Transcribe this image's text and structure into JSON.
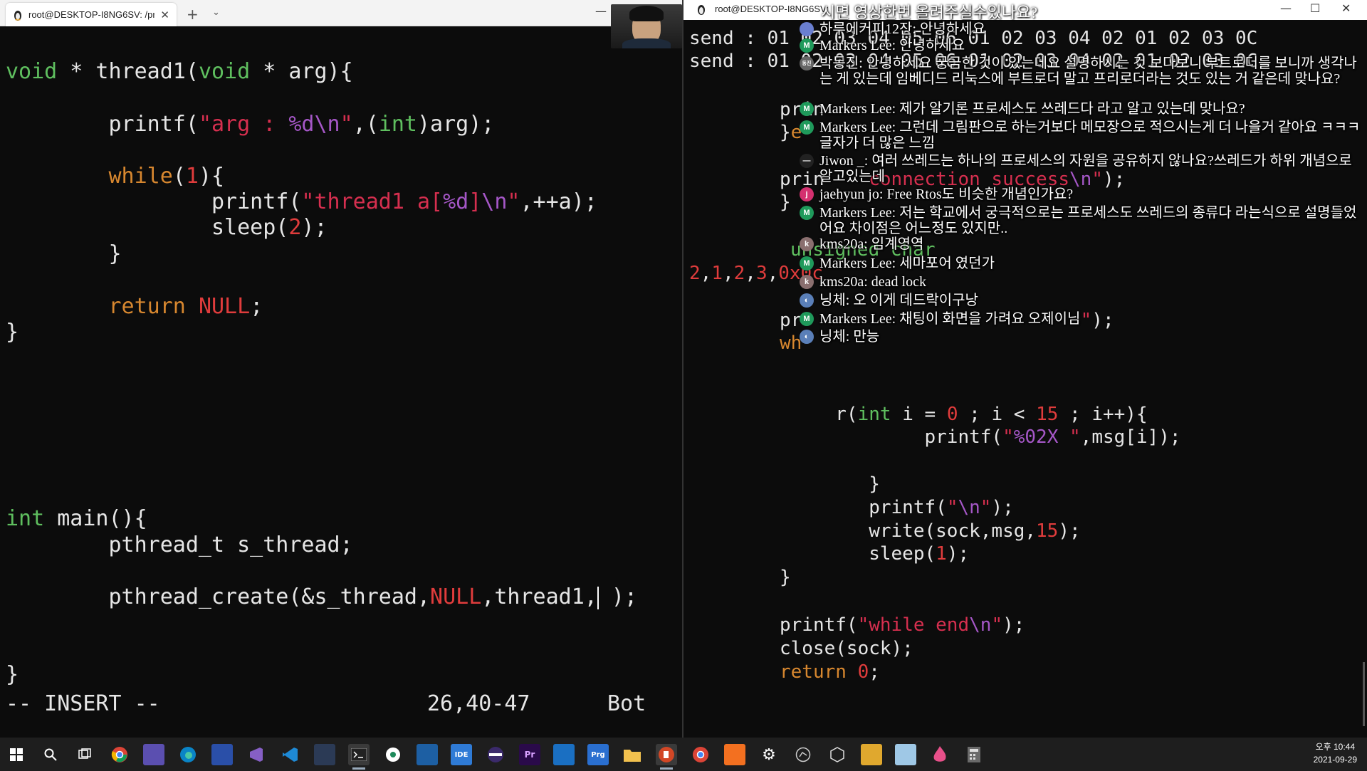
{
  "left_window": {
    "tab_title": "root@DESKTOP-I8NG6SV: /prc",
    "tab_close": "✕",
    "new_tab": "+",
    "tab_dropdown": "⌄",
    "minimize": "—",
    "maximize": "☐",
    "close": "✕",
    "status_mode": "-- INSERT --",
    "cursor_position": "26,40-47",
    "scroll_position": "Bot"
  },
  "right_window": {
    "title": "root@DESKTOP-I8NG6SV:",
    "minimize": "—",
    "maximize": "☐",
    "close": "✕"
  },
  "chat": {
    "overlay_title": "시면 영상한번 올려주실수있나요?",
    "messages": [
      {
        "name": "하루에커피12잔:",
        "text": "안녕하세요",
        "avatar": "",
        "color": "#6a7fd0"
      },
      {
        "name": "Markers Lee:",
        "text": "안녕하세요",
        "avatar": "M",
        "color": "#1f9a5b"
      },
      {
        "name": "박동진:",
        "text": "안녕하세요 궁금한 것이 있는데요 설명하시는 것 보다보니 부트로더를 보니까 생각나는 게 있는데 임베디드 리눅스에 부트로더 말고 프리로더라는 것도 있는 거 같은데 맞나요?",
        "avatar": "동진",
        "color": "#666666"
      },
      {
        "name": "Markers Lee:",
        "text": "제가 알기론 프로세스도 쓰레드다 라고 알고 있는데 맞나요?",
        "avatar": "M",
        "color": "#1f9a5b"
      },
      {
        "name": "Markers Lee:",
        "text": "그런데 그림판으로 하는거보다 메모장으로 적으시는게 더 나을거 같아요 ㅋㅋㅋ 글자가 더 많은 느낌",
        "avatar": "M",
        "color": "#1f9a5b"
      },
      {
        "name": "Jiwon _:",
        "text": "여러 쓰레드는 하나의 프로세스의 자원을 공유하지 않나요?쓰레드가 하위 개념으로 알고있는데",
        "avatar": "—",
        "color": "#222222"
      },
      {
        "name": "jaehyun jo:",
        "text": "Free Rtos도 비슷한 개념인가요?",
        "avatar": "j",
        "color": "#d4306f"
      },
      {
        "name": "Markers Lee:",
        "text": "저는 학교에서 궁극적으로는 프로세스도 쓰레드의 종류다 라는식으로 설명들었어요 차이점은 어느정도 있지만..",
        "avatar": "M",
        "color": "#1f9a5b"
      },
      {
        "name": "kms20a:",
        "text": "임계영역",
        "avatar": "k",
        "color": "#8a6f6f"
      },
      {
        "name": "Markers Lee:",
        "text": "세마포어 였던가",
        "avatar": "M",
        "color": "#1f9a5b"
      },
      {
        "name": "kms20a:",
        "text": "dead lock",
        "avatar": "k",
        "color": "#8a6f6f"
      },
      {
        "name": "닝체:",
        "text": "오 이게 데드락이구낭",
        "avatar": "◐",
        "color": "#5a7fb8"
      },
      {
        "name": "Markers Lee:",
        "text": "채팅이 화면을 가려요 오제이님",
        "avatar": "M",
        "color": "#1f9a5b"
      },
      {
        "name": "닝체:",
        "text": "만능",
        "avatar": "◐",
        "color": "#5a7fb8"
      }
    ]
  },
  "taskbar": {
    "icons": [
      "windows-start",
      "search",
      "task-view",
      "chrome",
      "app-purple",
      "edge",
      "app-blue",
      "visual-studio",
      "vscode",
      "app-dark",
      "terminal",
      "app-circle",
      "app-window",
      "ide",
      "app-eclipse",
      "premiere-pro",
      "app-store",
      "prog",
      "file-explorer",
      "powerpoint",
      "chrome-alt",
      "xampp",
      "settings",
      "app-gray",
      "app-3d",
      "app-yellow",
      "app-cloud",
      "app-flame",
      "calculator"
    ],
    "ide_label": "IDE",
    "pr_label": "Pr",
    "prg_label": "Prg",
    "time": "오후 10:44",
    "date": "2021-09-29"
  }
}
